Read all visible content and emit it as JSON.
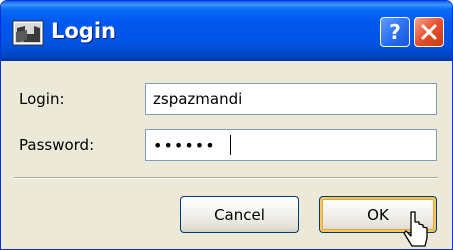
{
  "window": {
    "title": "Login",
    "help_label": "?",
    "close_icon": "close-icon",
    "app_icon": "login-app-icon"
  },
  "form": {
    "login_label": "Login:",
    "login_value": "zspazmandi",
    "password_label": "Password:",
    "password_value": "••••••"
  },
  "buttons": {
    "cancel_label": "Cancel",
    "ok_label": "OK"
  },
  "colors": {
    "titlebar": "#0054e3",
    "dialog_bg": "#ece9d8",
    "close_button": "#e5502e",
    "default_button_highlight": "#f7c95c"
  }
}
